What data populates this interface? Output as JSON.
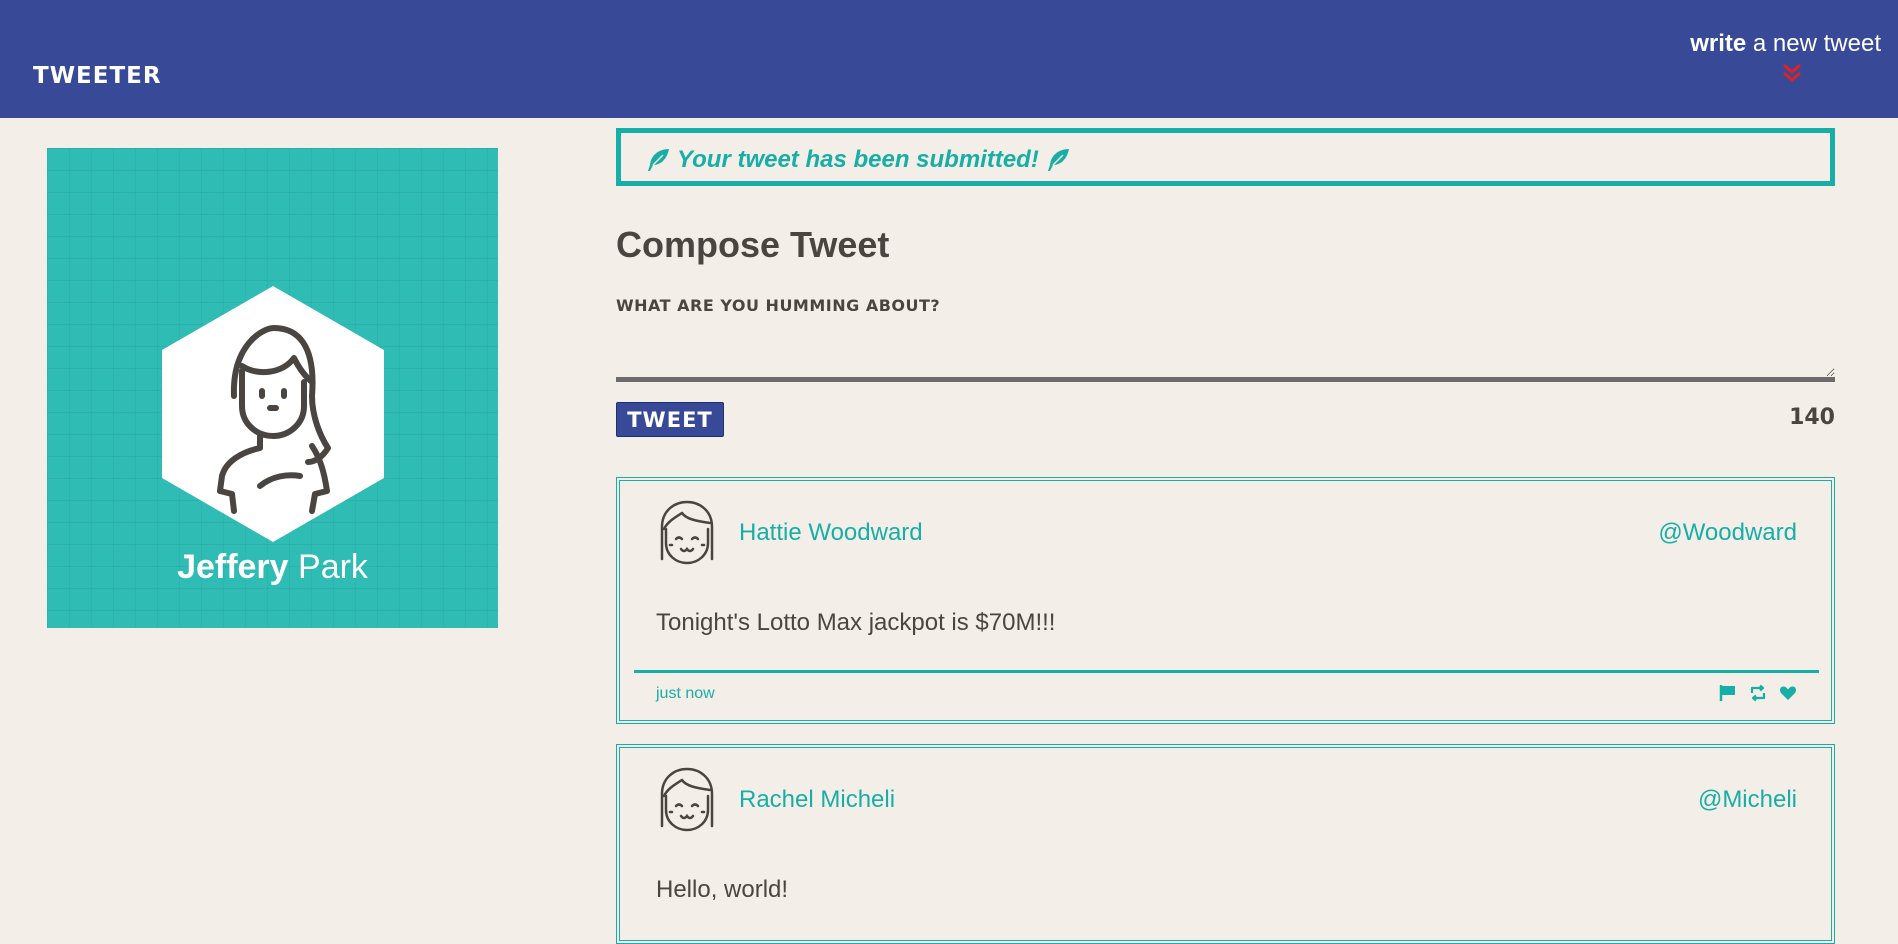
{
  "nav": {
    "brand": "TWEETER",
    "write_bold": "write",
    "write_rest": " a new tweet",
    "chevron_icon": "double-chevron-down-icon",
    "background": "#384a97",
    "chevron_color": "#e0211f"
  },
  "profile": {
    "first_name": "Jeffery",
    "last_name": " Park",
    "avatar_icon": "woman-avatar-icon",
    "background": "#2ebcb4"
  },
  "alert": {
    "message": "Your tweet has been submitted!",
    "icon": "feather-icon",
    "color": "#17aea7"
  },
  "compose": {
    "title": "Compose Tweet",
    "label": "WHAT ARE YOU HUMMING ABOUT?",
    "value": "",
    "button_label": "TWEET",
    "counter": "140"
  },
  "tweets": [
    {
      "name": "Hattie Woodward",
      "handle": "@Woodward",
      "body": "Tonight's Lotto Max jackpot is $70M!!!",
      "time": "just now",
      "avatar_icon": "smiling-girl-avatar-icon",
      "actions": [
        "flag-icon",
        "retweet-icon",
        "heart-icon"
      ]
    },
    {
      "name": "Rachel Micheli",
      "handle": "@Micheli",
      "body": "Hello, world!",
      "avatar_icon": "smiling-girl-avatar-icon"
    }
  ]
}
